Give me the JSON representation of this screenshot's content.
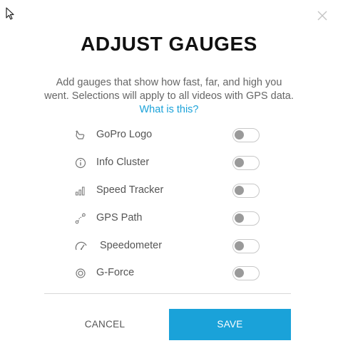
{
  "dialog": {
    "title": "ADJUST GAUGES",
    "description_line1": "Add gauges that show how fast, far, and high you",
    "description_line2": "went. Selections will apply to all videos with GPS data.",
    "help_link": "What is this?",
    "gauges": [
      {
        "label": "GoPro Logo",
        "icon": "hand-point-icon",
        "enabled": false
      },
      {
        "label": "Info Cluster",
        "icon": "info-icon",
        "enabled": false
      },
      {
        "label": "Speed Tracker",
        "icon": "bar-chart-icon",
        "enabled": false
      },
      {
        "label": "GPS Path",
        "icon": "gps-path-icon",
        "enabled": false
      },
      {
        "label": "Speedometer",
        "icon": "speedometer-icon",
        "enabled": false
      },
      {
        "label": "G-Force",
        "icon": "target-icon",
        "enabled": false
      }
    ],
    "cancel_label": "CANCEL",
    "save_label": "SAVE"
  },
  "colors": {
    "accent": "#1aa2d9",
    "toggle_knob_off": "#9a9a9a",
    "toggle_border": "#c8c8c8",
    "title": "#111111"
  }
}
